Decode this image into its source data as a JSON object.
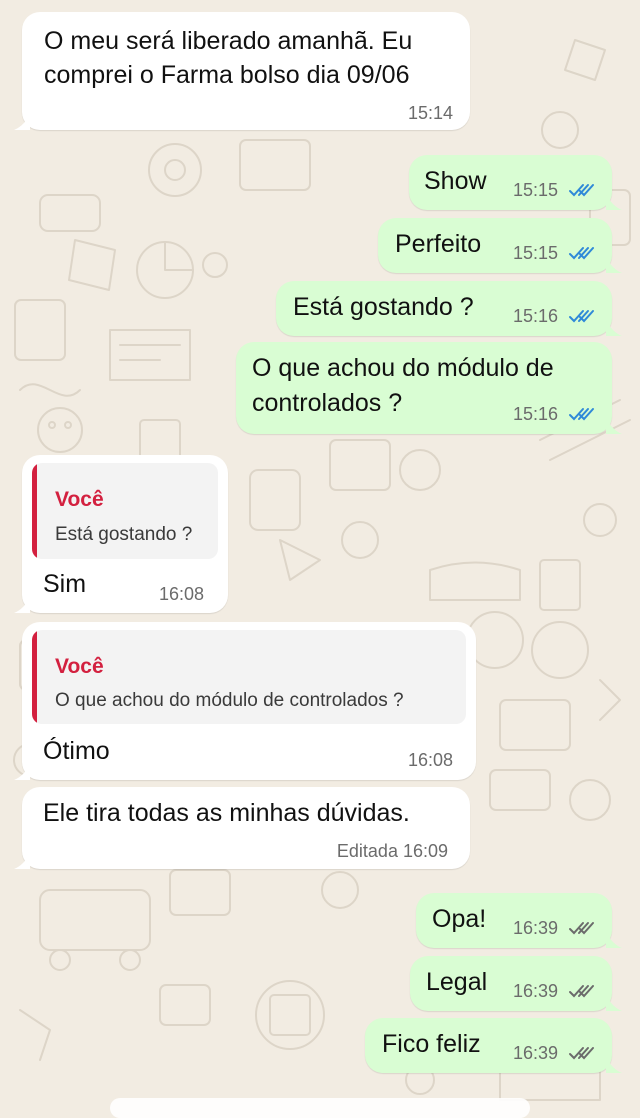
{
  "colors": {
    "background": "#f2ece2",
    "incoming_bubble": "#ffffff",
    "outgoing_bubble": "#d9fdd3",
    "read_ticks": "#2f89d8",
    "delivered_ticks": "#6b6b6b",
    "quote_accent": "#d3203f"
  },
  "messages": [
    {
      "direction": "incoming",
      "text_line1": "O meu será liberado amanhã. Eu",
      "text_line2": "comprei o Farma bolso dia 09/06",
      "time": "15:14"
    },
    {
      "direction": "outgoing",
      "text": "Show",
      "time": "15:15",
      "status": "read"
    },
    {
      "direction": "outgoing",
      "text": "Perfeito",
      "time": "15:15",
      "status": "read"
    },
    {
      "direction": "outgoing",
      "text": "Está gostando ?",
      "time": "15:16",
      "status": "read"
    },
    {
      "direction": "outgoing",
      "text_line1": "O que achou do módulo de",
      "text_line2": "controlados ?",
      "time": "15:16",
      "status": "read"
    },
    {
      "direction": "incoming",
      "quote_author": "Você",
      "quote_text": "Está gostando ?",
      "text": "Sim",
      "time": "16:08"
    },
    {
      "direction": "incoming",
      "quote_author": "Você",
      "quote_text": "O que achou do módulo de controlados ?",
      "text": "Ótimo",
      "time": "16:08"
    },
    {
      "direction": "incoming",
      "text": "Ele tira todas as minhas dúvidas.",
      "time": "Editada 16:09"
    },
    {
      "direction": "outgoing",
      "text": "Opa!",
      "time": "16:39",
      "status": "delivered"
    },
    {
      "direction": "outgoing",
      "text": "Legal",
      "time": "16:39",
      "status": "delivered"
    },
    {
      "direction": "outgoing",
      "text": "Fico feliz",
      "time": "16:39",
      "status": "delivered"
    }
  ]
}
